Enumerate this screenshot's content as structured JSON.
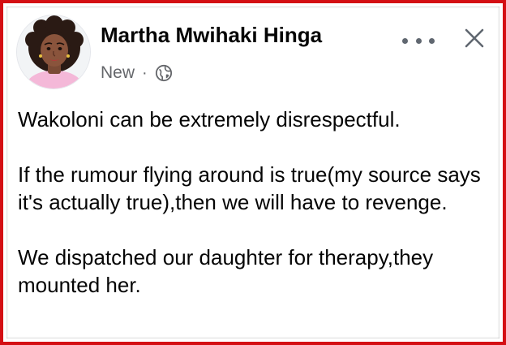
{
  "post": {
    "author": "Martha Mwihaki Hinga",
    "meta_label": "New",
    "separator": "·",
    "privacy_icon": "globe-icon",
    "more_icon": "more-options-icon",
    "close_icon": "close-icon",
    "paragraphs": [
      "Wakoloni can be extremely disrespectful.",
      "If the rumour flying around is true(my source says it's actually true),then we will have to revenge.",
      "We dispatched our daughter for therapy,they mounted her."
    ]
  },
  "colors": {
    "frame_border": "#d40f14",
    "meta_text": "#65676b",
    "body_text": "#050505"
  }
}
